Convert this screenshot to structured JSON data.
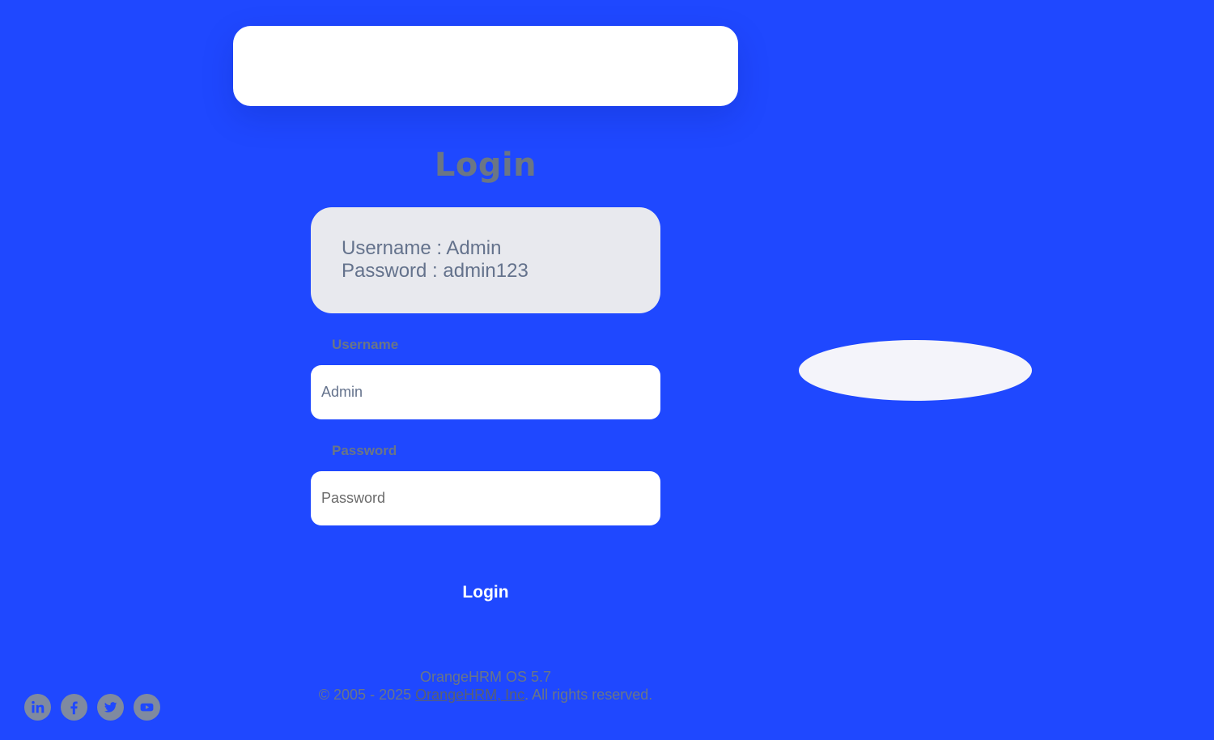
{
  "login_title": "Login",
  "credentials": {
    "username_line": "Username : Admin",
    "password_line": "Password : admin123"
  },
  "form": {
    "username_label": "Username",
    "username_value": "Admin",
    "password_label": "Password",
    "password_placeholder": "Password",
    "submit_label": "Login"
  },
  "footer": {
    "version": "OrangeHRM OS 5.7",
    "copyright_prefix": "© 2005 - 2025 ",
    "company_link": "OrangeHRM, Inc",
    "copyright_suffix": ". All rights reserved."
  },
  "social_icons": [
    "linkedin-icon",
    "facebook-icon",
    "twitter-icon",
    "youtube-icon"
  ],
  "colors": {
    "background": "#1f48ff",
    "card": "#ffffff",
    "credential_box": "#e8e9ee",
    "muted_text": "#6b7685",
    "social_icon": "#7f8aa0"
  }
}
